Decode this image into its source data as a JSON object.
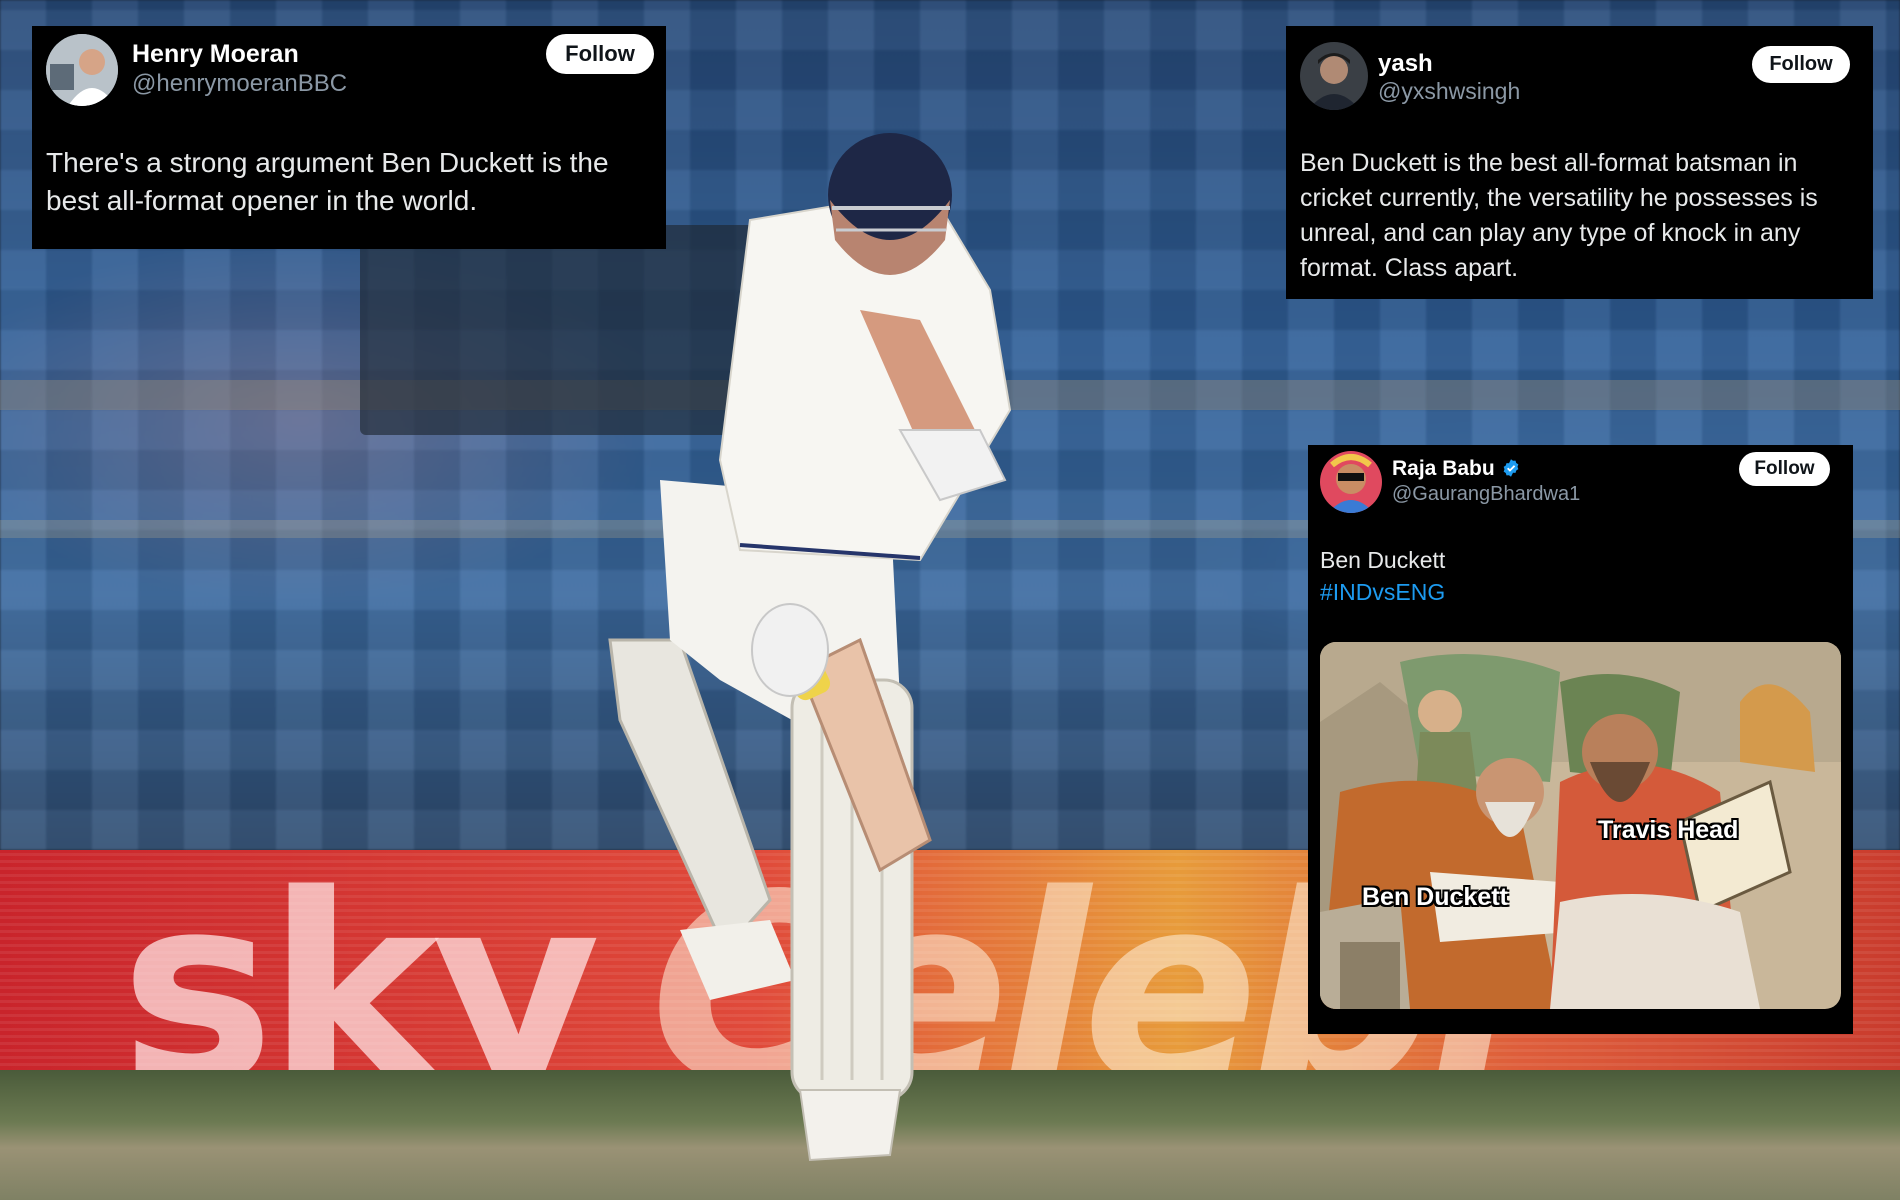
{
  "tweets": [
    {
      "name": "Henry Moeran",
      "handle": "@henrymoeranBBC",
      "follow_label": "Follow",
      "text": "There's a strong argument Ben Duckett is the best all-format opener in the world."
    },
    {
      "name": "yash",
      "handle": "@yxshwsingh",
      "follow_label": "Follow",
      "text": "Ben Duckett is the best all-format batsman in cricket currently, the versatility he possesses is unreal, and can play any type of knock in any format. Class apart."
    },
    {
      "name": "Raja Babu",
      "verified": true,
      "handle": "@GaurangBhardwa1",
      "follow_label": "Follow",
      "text": "Ben Duckett",
      "hashtag": "#INDvsENG",
      "meme": {
        "label_right": "Travis Head",
        "label_left": "Ben Duckett"
      }
    }
  ],
  "colors": {
    "card_bg": "#000000",
    "handle_gray": "#8b98a5",
    "hashtag_blue": "#1d9bf0",
    "verified_blue": "#1d9bf0"
  }
}
